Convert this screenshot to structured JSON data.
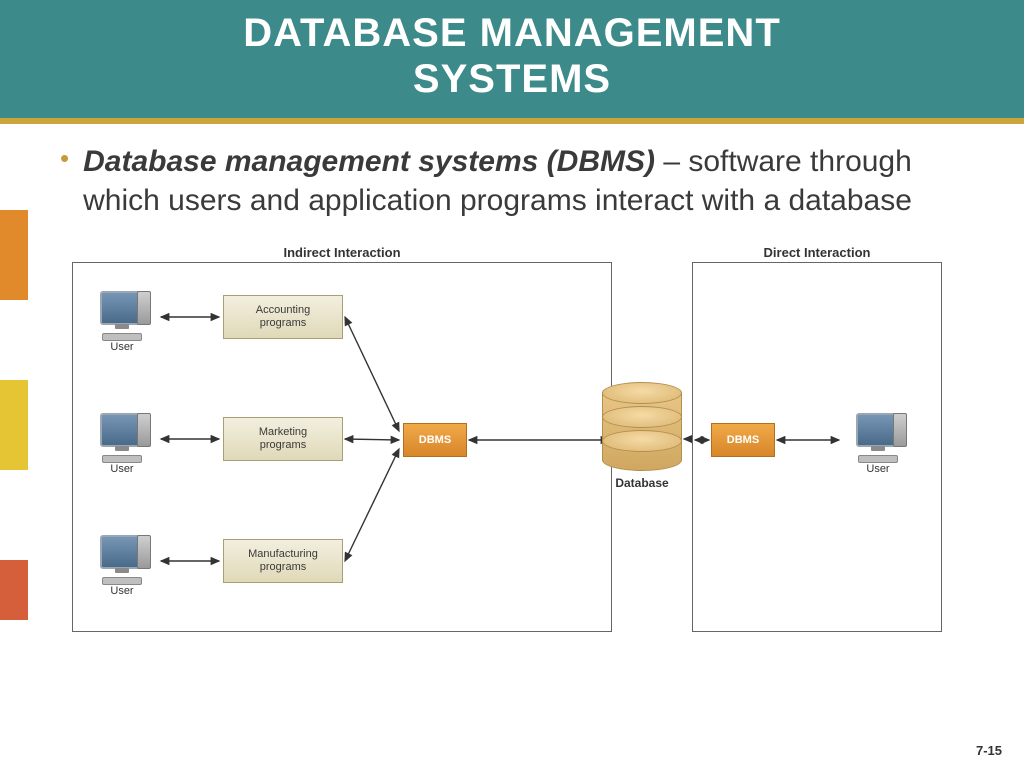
{
  "header": {
    "title_line1": "DATABASE MANAGEMENT",
    "title_line2": "SYSTEMS"
  },
  "bullet": {
    "term": "Database management systems (DBMS)",
    "dash": " – ",
    "definition": "software through which users and application programs interact with a database"
  },
  "diagram": {
    "left_panel_title": "Indirect Interaction",
    "right_panel_title": "Direct Interaction",
    "user_label": "User",
    "programs": {
      "accounting": "Accounting\nprograms",
      "marketing": "Marketing\nprograms",
      "manufacturing": "Manufacturing\nprograms"
    },
    "dbms_label": "DBMS",
    "database_label": "Database"
  },
  "page_number": "7-15",
  "colors": {
    "header_bg": "#3d8a8a",
    "accent_gold": "#c9a53b",
    "dbms_orange": "#e08a2c"
  }
}
